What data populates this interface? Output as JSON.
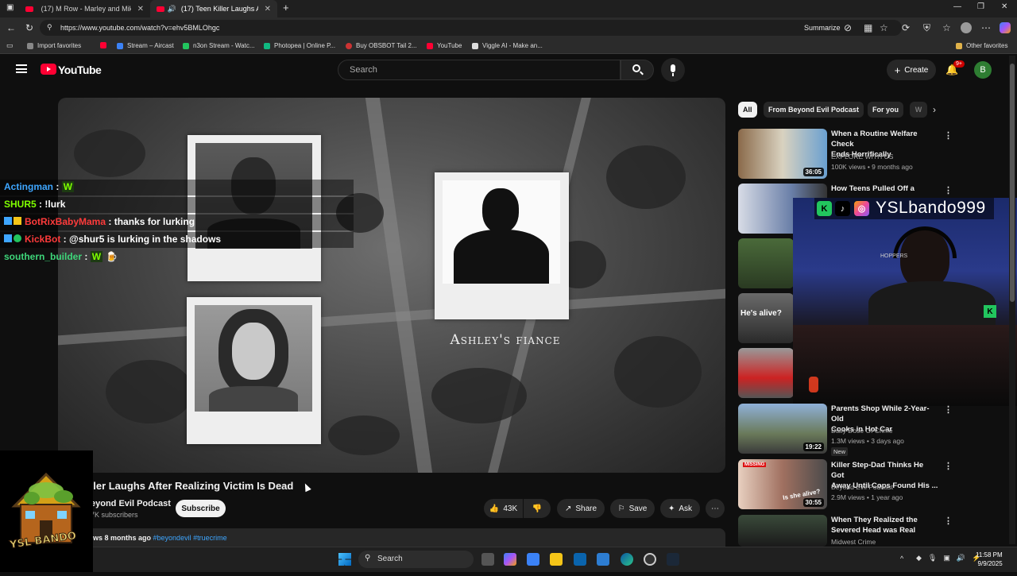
{
  "browser": {
    "tabs": [
      {
        "label": "(17) M Row - Marley and Mike (C",
        "active": false
      },
      {
        "label": "(17) Teen Killer Laughs After",
        "active": true
      }
    ],
    "new_tab_symbol": "+",
    "url": "https://www.youtube.com/watch?v=ehv5BMLOhgc",
    "summarize_label": "Summarize",
    "bookmarks": [
      {
        "label": "Import favorites",
        "color": "#888888"
      },
      {
        "label": "Stream – Aircast",
        "color": "#3b82f6"
      },
      {
        "label": "n3on Stream - Watc...",
        "color": "#22c55e"
      },
      {
        "label": "Photopea | Online P...",
        "color": "#10b981"
      },
      {
        "label": "Buy OBSBOT Tail 2...",
        "color": "#cc3333"
      },
      {
        "label": "YouTube",
        "color": "#ff0033"
      },
      {
        "label": "Viggle AI - Make an...",
        "color": "#dddddd"
      }
    ],
    "other_favorites": "Other favorites"
  },
  "youtube": {
    "logo_text": "YouTube",
    "search_placeholder": "Search",
    "create_label": "Create",
    "notif_count": "9+",
    "avatar_letter": "B"
  },
  "video": {
    "caption": "Ashley's fiance",
    "title": "iller Laughs After Realizing Victim Is Dead",
    "channel": "eyond Evil Podcast",
    "subscribers": "7K subscribers",
    "subscribe_label": "Subscribe",
    "likes": "43K",
    "share_label": "Share",
    "save_label": "Save",
    "ask_label": "Ask",
    "meta_views": "ws 8 months ago",
    "meta_tags": "#beyondevil #truecrime"
  },
  "chat": [
    {
      "user": "Actingman",
      "msg": "",
      "color": "#3ea6ff",
      "emote": "W"
    },
    {
      "user": "SHUR5",
      "msg": "!lurk",
      "color": "#7fff00",
      "emote": ""
    },
    {
      "user": "BotRixBabyMama",
      "msg": "thanks for lurking",
      "color": "#ff3b3b",
      "emote": ""
    },
    {
      "user": "KickBot",
      "msg": "@shur5 is lurking in the shadows",
      "color": "#ff3b3b",
      "emote": ""
    },
    {
      "user": "southern_builder",
      "msg": "",
      "color": "#3ed67a",
      "emote": "W"
    }
  ],
  "chips": [
    "All",
    "From Beyond Evil Podcast",
    "For you",
    "W"
  ],
  "recommendations": [
    {
      "title_line1": "When a Routine Welfare Check",
      "title_line2": "Ends Horrifically",
      "channel": "EXPLORE WITH US",
      "meta": "100K views • 9 months ago",
      "duration": "36:05",
      "new": ""
    },
    {
      "title_line1": "How Teens Pulled Off a",
      "title_line2": "",
      "channel": "",
      "meta": "",
      "duration": "",
      "new": ""
    },
    {
      "title_line1": "",
      "title_line2": "",
      "channel": "",
      "meta": "",
      "duration": "",
      "new": ""
    },
    {
      "title_line1": "He's alive?",
      "title_line2": "",
      "channel": "",
      "meta": "",
      "duration": "",
      "new": ""
    },
    {
      "title_line1": "",
      "title_line2": "",
      "channel": "",
      "meta": "",
      "duration": "",
      "new": ""
    },
    {
      "title_line1": "Parents Shop While 2-Year-Old",
      "title_line2": "Cooks in Hot Car",
      "channel": "Daily Dose Of Crime",
      "meta": "1.3M views • 3 days ago",
      "duration": "19:22",
      "new": "New"
    },
    {
      "title_line1": "Killer Step-Dad Thinks He Got",
      "title_line2": "Away Until Cops Found His ...",
      "channel": "Beyond Evil Podcast",
      "meta": "2.9M views • 1 year ago",
      "duration": "30:55",
      "new": ""
    },
    {
      "title_line1": "When They Realized the",
      "title_line2": "Severed Head was Real",
      "channel": "Midwest Crime",
      "meta": "",
      "duration": "",
      "new": ""
    }
  ],
  "thumb_overlays": {
    "missing": "MISSING",
    "is_she_alive": "Is she alive?"
  },
  "webcam": {
    "handle": "YSLbando999",
    "shirt_text": "HOPPERS"
  },
  "logo_overlay_text": "YSL BANDO",
  "taskbar": {
    "search_label": "Search",
    "time": "11:58 PM",
    "date": "9/9/2025"
  }
}
